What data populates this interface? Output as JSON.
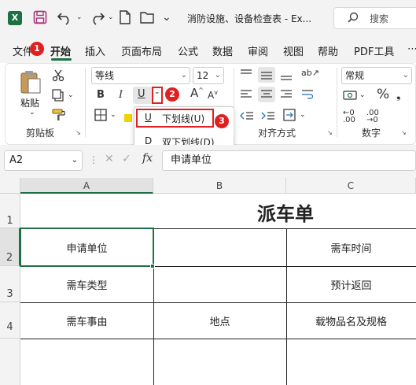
{
  "titlebar": {
    "app_logo": "X",
    "doc_title": "消防设施、设备检查表 - Ex...",
    "search_placeholder": "搜索"
  },
  "menu": {
    "tabs": [
      "文件",
      "开始",
      "插入",
      "页面布局",
      "公式",
      "数据",
      "审阅",
      "视图",
      "帮助",
      "PDF工具"
    ],
    "active": "开始"
  },
  "ribbon": {
    "clipboard": {
      "paste_label": "粘贴",
      "group_label": "剪贴板"
    },
    "font": {
      "font_name": "等线",
      "font_size": "12",
      "bold": "B",
      "italic": "I",
      "underline": "U",
      "border_icon": "border-icon",
      "grow": "A",
      "shrink": "A"
    },
    "alignment": {
      "group_label": "对齐方式"
    },
    "number": {
      "format": "常规",
      "percent": "%",
      "group_label": "数字"
    }
  },
  "underline_dropdown": {
    "items": [
      {
        "icon": "U",
        "label": "下划线(U)"
      },
      {
        "icon": "D",
        "label": "双下划线(D)"
      }
    ]
  },
  "markers": [
    "1",
    "2",
    "3"
  ],
  "formula_bar": {
    "name_box": "A2",
    "fx": "fx",
    "content": "申请单位"
  },
  "grid": {
    "columns": [
      "A",
      "B",
      "C"
    ],
    "rows": [
      "1",
      "2",
      "3",
      "4"
    ],
    "title": "派车单",
    "cells": {
      "A2": "申请单位",
      "C2": "需车时间",
      "A3": "需车类型",
      "C3": "预计返回",
      "A4": "需车事由",
      "B4": "地点",
      "C4": "载物品名及规格"
    }
  },
  "colors": {
    "accent": "#1e7145",
    "marker": "#e02020"
  }
}
